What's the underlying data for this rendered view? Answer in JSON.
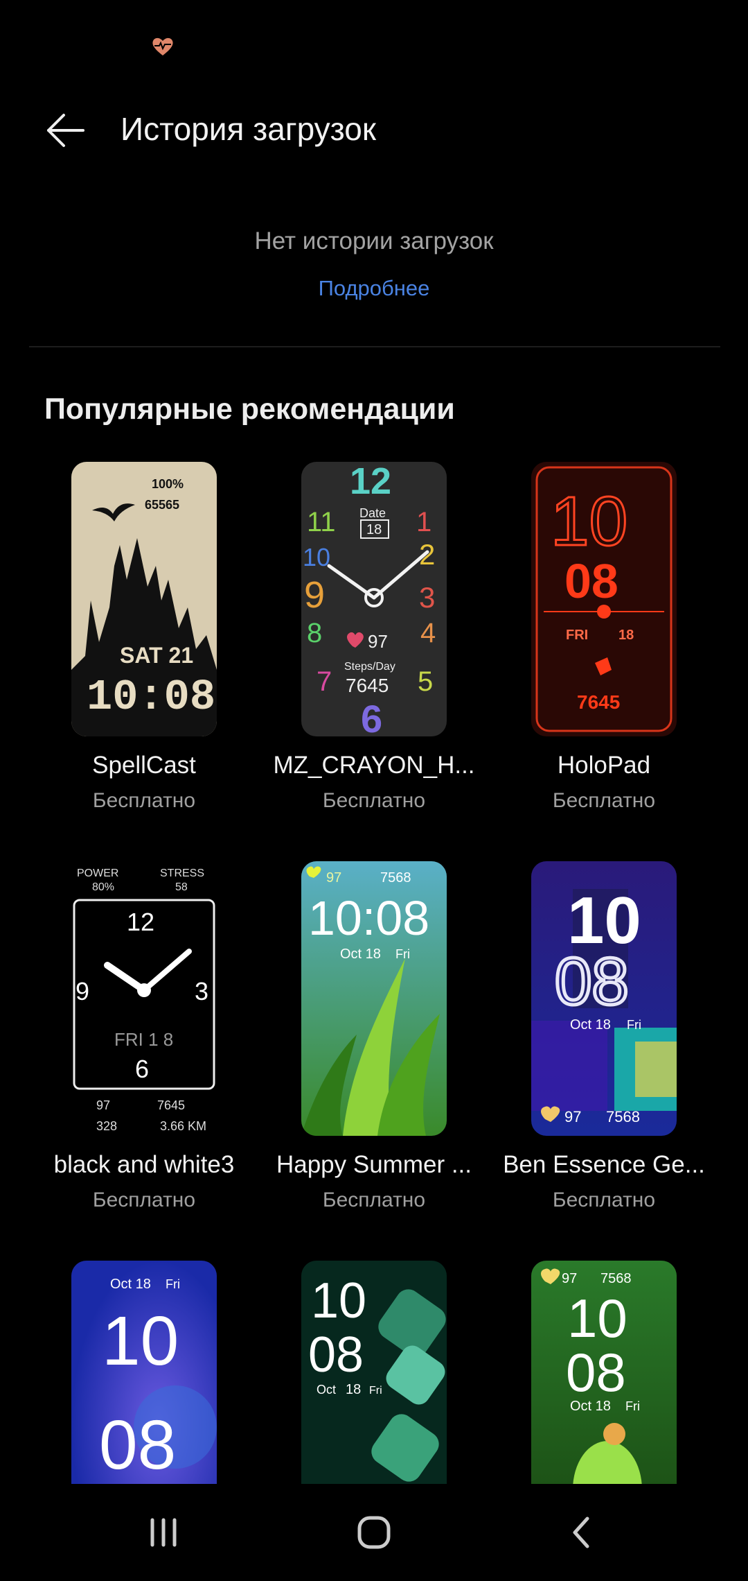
{
  "header": {
    "title": "История загрузок"
  },
  "empty_state": {
    "message": "Нет истории загрузок",
    "link": "Подробнее"
  },
  "recommendations": {
    "title": "Популярные рекомендации",
    "items": [
      {
        "name": "SpellCast",
        "price": "Бесплатно",
        "face": {
          "battery": "100%",
          "steps": "65565",
          "date": "SAT 21",
          "time": "10:08"
        }
      },
      {
        "name": "MZ_CRAYON_H...",
        "price": "Бесплатно",
        "face": {
          "date_label": "Date",
          "day": "18",
          "heart": "97",
          "steps_label": "Steps/Day",
          "steps": "7645",
          "numerals": [
            "12",
            "1",
            "2",
            "3",
            "4",
            "5",
            "6",
            "7",
            "8",
            "9",
            "10",
            "11"
          ]
        }
      },
      {
        "name": "HoloPad",
        "price": "Бесплатно",
        "face": {
          "hour": "10",
          "minute": "08",
          "day": "FRI",
          "date": "18",
          "steps": "7645"
        }
      },
      {
        "name": "black and white3",
        "price": "Бесплатно",
        "face": {
          "power_label": "POWER",
          "power": "80%",
          "stress_label": "STRESS",
          "stress": "58",
          "n12": "12",
          "n3": "3",
          "n6": "6",
          "n9": "9",
          "date": "FRI 1 8",
          "heart": "97",
          "steps": "7645",
          "calories": "328",
          "distance": "3.66 KM"
        }
      },
      {
        "name": "Happy Summer ...",
        "price": "Бесплатно",
        "face": {
          "heart": "97",
          "steps": "7568",
          "time": "10:08",
          "date": "Oct 18",
          "day": "Fri"
        }
      },
      {
        "name": "Ben Essence Ge...",
        "price": "Бесплатно",
        "face": {
          "hour": "10",
          "minute": "08",
          "date": "Oct 18",
          "day": "Fri",
          "heart": "97",
          "steps": "7568"
        }
      },
      {
        "name": "",
        "price": "",
        "face": {
          "date": "Oct 18",
          "day": "Fri",
          "hour": "10",
          "minute": "08"
        }
      },
      {
        "name": "",
        "price": "",
        "face": {
          "hour": "10",
          "minute": "08",
          "date": "Oct",
          "day_num": "18",
          "day": "Fri"
        }
      },
      {
        "name": "",
        "price": "",
        "face": {
          "heart": "97",
          "steps": "7568",
          "hour": "10",
          "minute": "08",
          "date": "Oct 18",
          "day": "Fri"
        }
      }
    ]
  },
  "colors": {
    "accent": "#4a83e3",
    "status_heart": "#e0876a",
    "background": "#000000"
  },
  "icons": {
    "status": "heart-pulse-icon",
    "back": "arrow-left-icon",
    "nav": [
      "recent-apps-icon",
      "home-icon",
      "back-chevron-icon"
    ]
  }
}
